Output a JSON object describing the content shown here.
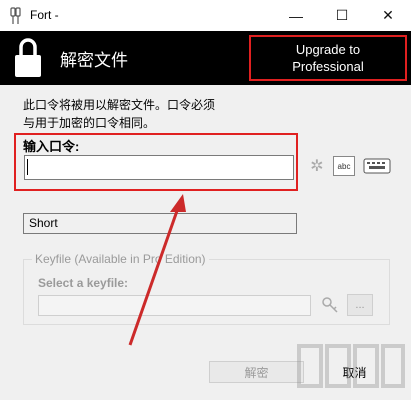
{
  "window": {
    "title": "Fort -",
    "minimize_glyph": "—",
    "maximize_glyph": "☐",
    "close_glyph": "✕"
  },
  "header": {
    "title": "解密文件",
    "upgrade_line1": "Upgrade to",
    "upgrade_line2": "Professional"
  },
  "description": {
    "line1": "此口令将被用以解密文件。口令必须",
    "line2": "与用于加密的口令相同。"
  },
  "password": {
    "label": "输入口令:",
    "value": ""
  },
  "tools": {
    "generate_glyph": "✲",
    "show_text": "abc"
  },
  "strength": {
    "text": "Short"
  },
  "keyfile": {
    "group_label": "Keyfile (Available in Pro Edition)",
    "select_label": "Select a keyfile:",
    "value": "",
    "browse_label": "..."
  },
  "buttons": {
    "decrypt": "解密",
    "cancel": "取消"
  },
  "colors": {
    "header_bg": "#000000",
    "highlight": "#e02020",
    "arrow": "#cc2a2a"
  }
}
